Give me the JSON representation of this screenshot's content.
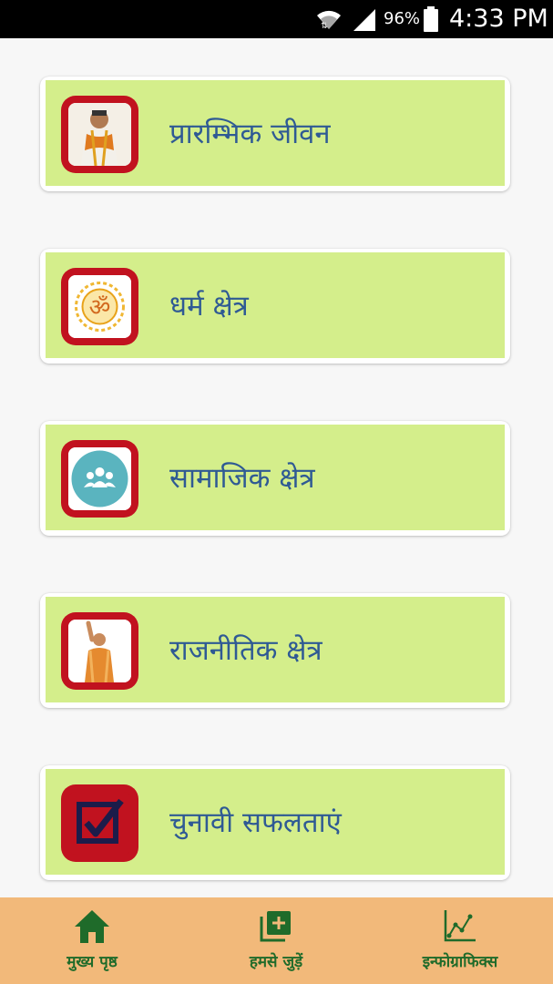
{
  "status_bar": {
    "battery_percent": "96%",
    "time": "4:33 PM",
    "icons": [
      "wifi-icon",
      "cell-signal-icon",
      "battery-icon"
    ]
  },
  "menu": {
    "items": [
      {
        "label": "प्रारम्भिक जीवन",
        "icon": "portrait-photo-icon"
      },
      {
        "label": "धर्म क्षेत्र",
        "icon": "om-symbol-icon"
      },
      {
        "label": "सामाजिक क्षेत्र",
        "icon": "people-group-icon"
      },
      {
        "label": "राजनीतिक क्षेत्र",
        "icon": "waving-leader-photo-icon"
      },
      {
        "label": "चुनावी सफलताएं",
        "icon": "checkbox-tick-icon"
      }
    ]
  },
  "bottom_nav": {
    "items": [
      {
        "label": "मुख्य पृष्ठ",
        "icon": "home-icon"
      },
      {
        "label": "हमसे जुड़ें",
        "icon": "add-box-icon"
      },
      {
        "label": "इन्फोग्राफिक्स",
        "icon": "line-chart-icon"
      }
    ]
  },
  "colors": {
    "card_fill": "#d4ee8b",
    "card_text": "#2f5a94",
    "icon_frame": "#c1121f",
    "nav_background": "#f2b97a",
    "nav_text": "#1f6b2a",
    "status_bar": "#000000"
  }
}
